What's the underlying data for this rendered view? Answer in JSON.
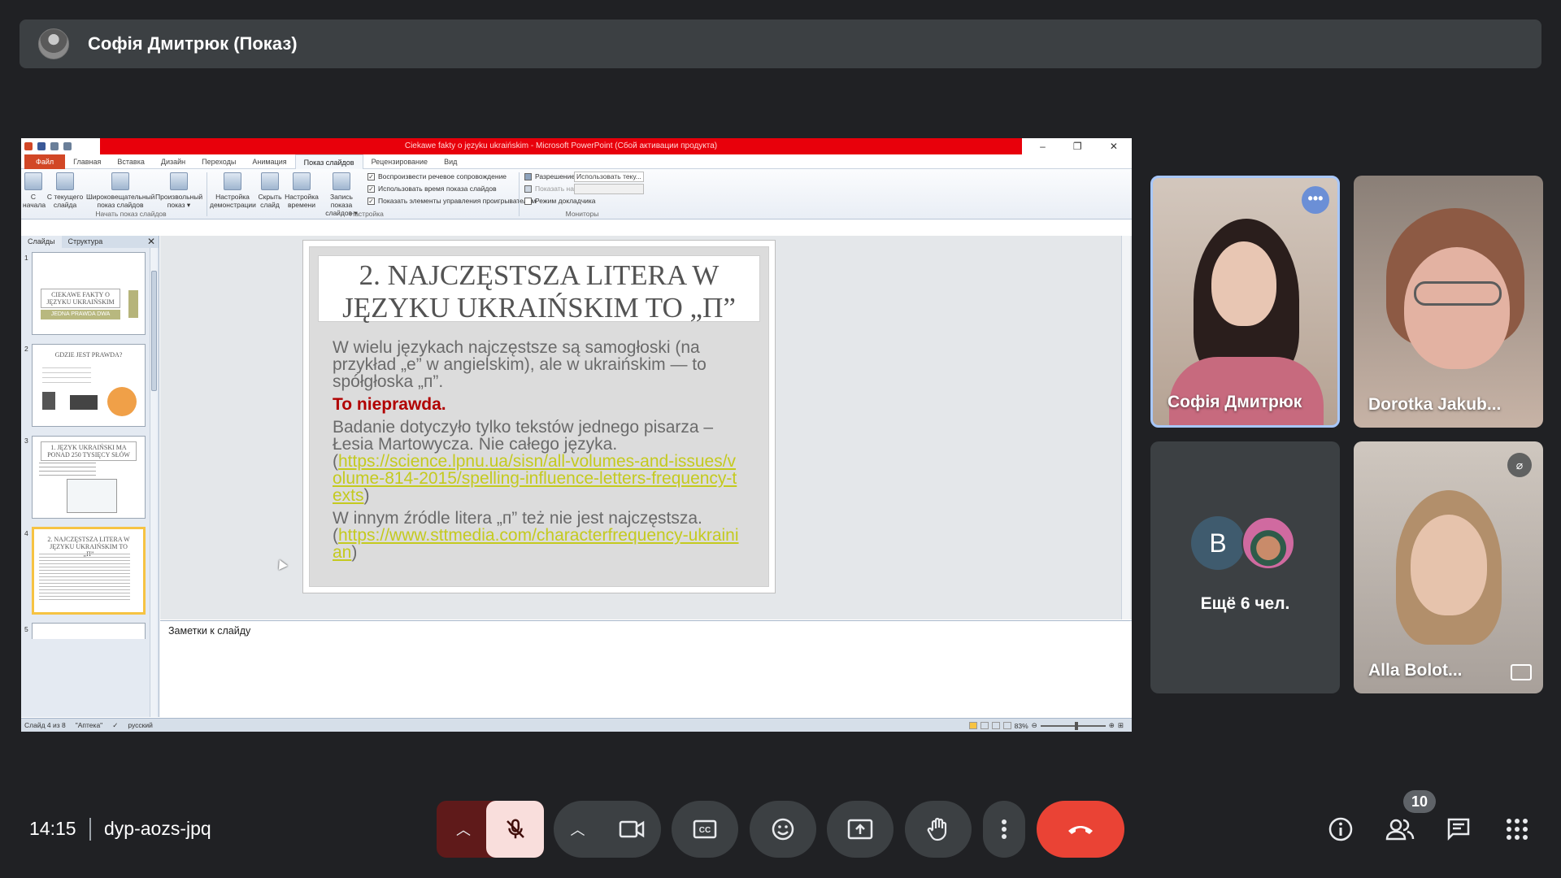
{
  "presenter": {
    "name": "Софія Дмитрюк (Показ)"
  },
  "window": {
    "title": "Ciekawe fakty o języku ukraińskim  -  Microsoft PowerPoint (Сбой активации продукта)",
    "controls": [
      "–",
      "❐",
      "✕"
    ]
  },
  "ribbon": {
    "tabs": [
      "Файл",
      "Главная",
      "Вставка",
      "Дизайн",
      "Переходы",
      "Анимация",
      "Показ слайдов",
      "Рецензирование",
      "Вид"
    ],
    "active_tab": "Показ слайдов",
    "buttons": {
      "from_start": "С\nначала",
      "from_current": "С текущего\nслайда",
      "broadcast": "Широковещательный\nпоказ слайдов",
      "custom": "Произвольный\nпоказ ▾",
      "setup": "Настройка\nдемонстрации",
      "hide": "Скрыть\nслайд",
      "rehearse": "Настройка\nвремени",
      "record": "Запись показа\nслайдов ▾"
    },
    "checks": {
      "narration": "Воспроизвести речевое сопровождение",
      "timings": "Использовать время показа слайдов",
      "media_controls": "Показать элементы управления проигрывателем",
      "presenter_view": "Режим докладчика"
    },
    "monitors": {
      "resolution_label": "Разрешение:",
      "resolution_value": "Использовать теку...",
      "show_on_label": "Показать на:"
    },
    "groups": {
      "start": "Начать показ слайдов",
      "setup": "Настройка",
      "monitors": "Мониторы"
    }
  },
  "panel": {
    "tabs": [
      "Слайды",
      "Структура"
    ],
    "close": "✕",
    "thumbs": [
      {
        "num": "1",
        "title": "CIEKAWE FAKTY O JĘZYKU UKRAIŃSKIM",
        "sub": "JEDNA PRAWDA  DWA KŁAMSTWA"
      },
      {
        "num": "2",
        "title": "GDZIE JEST PRAWDA?"
      },
      {
        "num": "3",
        "title": "1. JĘZYK UKRAIŃSKI MA PONAD 250 TYSIĘCY SŁÓW"
      },
      {
        "num": "4",
        "title": "2. NAJCZĘSTSZA LITERA W JĘZYKU UKRAIŃSKIM TO „П”"
      },
      {
        "num": "5",
        "title": ""
      }
    ]
  },
  "slide": {
    "title": "2. NAJCZĘSTSZA LITERA W JĘZYKU UKRAIŃSKIM TO „П”",
    "p1": "W wielu językach najczęstsze są samogłoski (na przykład „e” w angielskim), ale w ukraińskim — to spółgłoska „п”.",
    "verdict": "To nieprawda.",
    "p2": "Badanie dotyczyło tylko tekstów jednego pisarza – Łesia Martowycza. Nie całego języka.",
    "link1": "https://science.lpnu.ua/sisn/all-volumes-and-issues/volume-814-2015/spelling-influence-letters-frequency-texts",
    "p3": "W innym źródle litera „п” też nie jest najczęstsza.",
    "link2": "https://www.sttmedia.com/characterfrequency-ukrainian",
    "open_paren": "(",
    "close_paren": ")"
  },
  "notes": {
    "placeholder": "Заметки к слайду"
  },
  "status": {
    "slide": "Слайд 4 из 8",
    "theme": "\"Аптека\"",
    "language": "русский",
    "zoom": "83%",
    "zoom_fraction": 0.53
  },
  "tiles": {
    "sofia": "Софія Дмитрюк",
    "dorotka": "Dorotka Jakub...",
    "more_initial": "B",
    "more_label": "Ещё 6 чел.",
    "alla": "Alla Bolot..."
  },
  "bottom": {
    "time": "14:15",
    "code": "dyp-aozs-jpq",
    "people_count": "10"
  },
  "icons": [
    "mic-off-icon",
    "camera-icon",
    "captions-icon",
    "emoji-icon",
    "present-icon",
    "raise-hand-icon",
    "more-vert-icon",
    "end-call-icon",
    "info-icon",
    "people-icon",
    "chat-icon",
    "apps-icon"
  ],
  "colors": {
    "end_call": "#ea4335",
    "mic_off_bg": "#f9dedc",
    "ppt_titlebar": "#e8000b",
    "active_speaker": "#a8c7fa"
  }
}
